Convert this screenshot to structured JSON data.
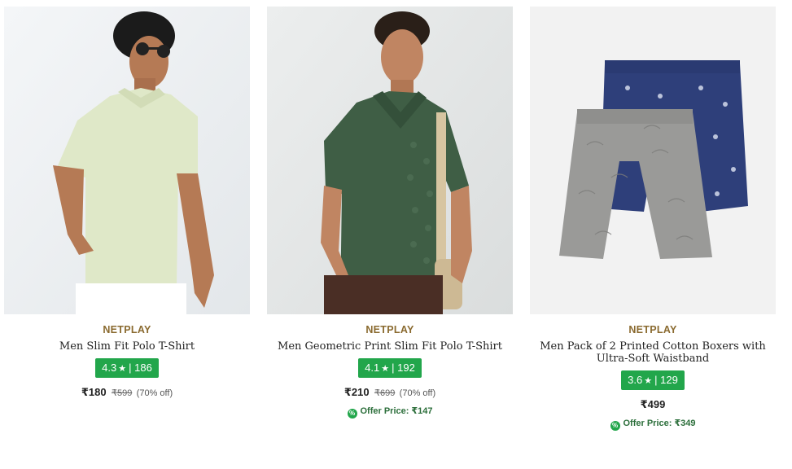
{
  "products": [
    {
      "brand": "NETPLAY",
      "name": "Men Slim Fit Polo T-Shirt",
      "rating": "4.3",
      "reviews": "| 186",
      "price": "₹180",
      "mrp": "₹599",
      "discount": "(70% off)",
      "image_icon": "product-image-polo-light"
    },
    {
      "brand": "NETPLAY",
      "name": "Men Geometric Print Slim Fit Polo T-Shirt",
      "rating": "4.1",
      "reviews": "| 192",
      "price": "₹210",
      "mrp": "₹699",
      "discount": "(70% off)",
      "offer_label": "Offer Price: ₹147",
      "image_icon": "product-image-polo-green"
    },
    {
      "brand": "NETPLAY",
      "name": "Men Pack of 2 Printed Cotton Boxers with Ultra-Soft Waistband",
      "rating": "3.6",
      "reviews": "| 129",
      "price": "₹499",
      "offer_label": "Offer Price: ₹349",
      "image_icon": "product-image-boxers"
    }
  ],
  "icons": {
    "star": "★",
    "offer": "%"
  },
  "colors": {
    "brand": "#8a6a2f",
    "rating_bg": "#22a64b",
    "offer_text": "#2b6e3a"
  }
}
